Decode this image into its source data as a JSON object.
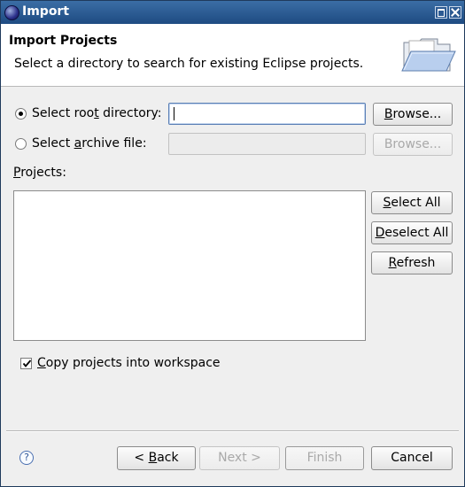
{
  "window": {
    "title": "Import"
  },
  "header": {
    "title": "Import Projects",
    "description": "Select a directory to search for existing Eclipse projects."
  },
  "source": {
    "root_option": {
      "label_before": "Select roo",
      "mnemonic": "t",
      "label_after": " directory:",
      "selected": true
    },
    "root_field": {
      "value": ""
    },
    "root_browse": {
      "mnemonic": "B",
      "label_rest": "rowse..."
    },
    "archive_option": {
      "label_before": "Select ",
      "mnemonic": "a",
      "label_after": "rchive file:",
      "selected": false
    },
    "archive_field": {
      "value": ""
    },
    "archive_browse": {
      "label": "Browse..."
    }
  },
  "projects": {
    "label_mnemonic": "P",
    "label_rest": "rojects:",
    "items": [],
    "select_all": {
      "mnemonic": "S",
      "label_rest": "elect All"
    },
    "deselect_all": {
      "mnemonic": "D",
      "label_rest": "eselect All"
    },
    "refresh": {
      "mnemonic": "R",
      "label_rest": "efresh"
    }
  },
  "copy_projects": {
    "mnemonic": "C",
    "label_rest": "opy projects into workspace",
    "checked": true
  },
  "footer": {
    "help": "?",
    "back": {
      "prefix": "< ",
      "mnemonic": "B",
      "label_rest": "ack"
    },
    "next": {
      "label": "Next >"
    },
    "finish": {
      "label": "Finish"
    },
    "cancel": {
      "label": "Cancel"
    }
  }
}
